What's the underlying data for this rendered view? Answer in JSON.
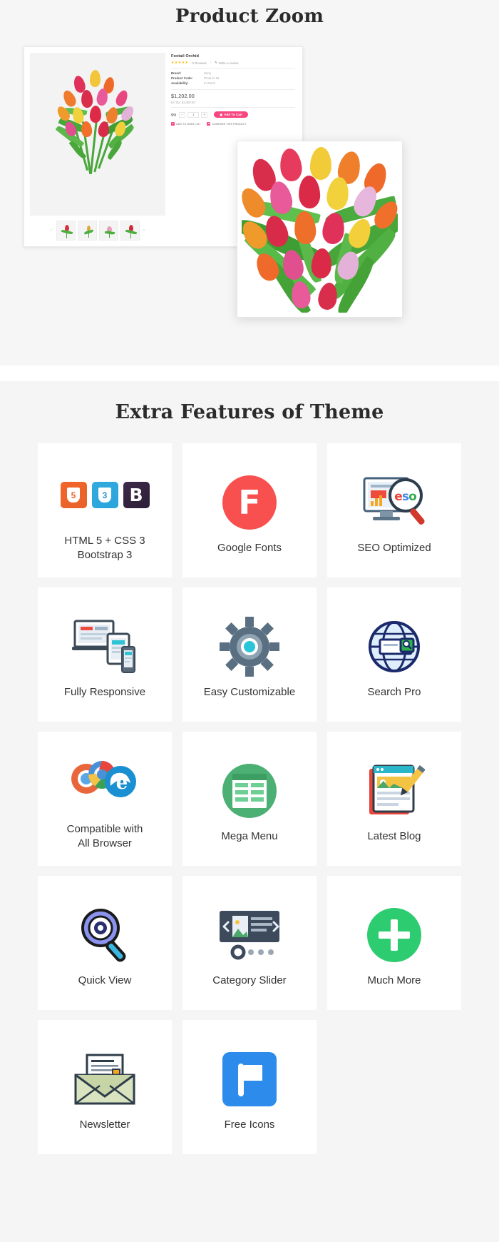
{
  "product_zoom": {
    "title": "Product Zoom",
    "product": {
      "name": "Foxtail Orchid",
      "stars": "★★★★★",
      "reviews": "0 Reviews",
      "separator": "|",
      "write_review": "Write a review",
      "pencil_icon": "pencil-icon",
      "specs": [
        {
          "key": "Brand:",
          "value": "Sony"
        },
        {
          "key": "Product Code:",
          "value": "Product 18"
        },
        {
          "key": "Availability:",
          "value": "In Stock"
        }
      ],
      "price": "$1,202.00",
      "ex_tax": "Ex Tax: $1,000.00",
      "qty_label": "Qty",
      "qty_minus": "−",
      "qty_value": "1",
      "qty_plus": "+",
      "add_to_cart": "Add To Cart",
      "cart_icon": "shopping-cart-icon",
      "wishlist": "ADD TO WISH LIST",
      "wishlist_icon": "heart-icon",
      "compare": "COMPARE THIS PRODUCT",
      "compare_icon": "exchange-icon",
      "prev_arrow": "‹",
      "next_arrow": "›",
      "thumbnails": [
        "thumbnail-1",
        "thumbnail-2",
        "thumbnail-3",
        "thumbnail-4"
      ]
    },
    "zoom_panel_name": "zoomed-product-image"
  },
  "features": {
    "title": "Extra Features of Theme",
    "cards": [
      {
        "label": "HTML 5 + CSS 3\nBootstrap 3",
        "icon": "html5-css3-bootstrap-icon",
        "label_line1": "HTML 5 + CSS 3",
        "label_line2": "Bootstrap 3"
      },
      {
        "label": "Google Fonts",
        "icon": "google-fonts-icon",
        "letter": "F"
      },
      {
        "label": "SEO Optimized",
        "icon": "seo-magnifier-icon",
        "seo_text": "seo"
      },
      {
        "label": "Fully Responsive",
        "icon": "responsive-devices-icon"
      },
      {
        "label": "Easy Customizable",
        "icon": "gear-icon"
      },
      {
        "label": "Search Pro",
        "icon": "globe-search-icon"
      },
      {
        "label": "Compatible with\nAll Browser",
        "icon": "browsers-icon",
        "label_line1": "Compatible with",
        "label_line2": "All Browser"
      },
      {
        "label": "Mega Menu",
        "icon": "mega-menu-icon"
      },
      {
        "label": "Latest Blog",
        "icon": "blog-pencil-icon"
      },
      {
        "label": "Quick View",
        "icon": "magnifier-eye-icon"
      },
      {
        "label": "Category Slider",
        "icon": "category-slider-icon"
      },
      {
        "label": "Much More",
        "icon": "plus-circle-icon"
      },
      {
        "label": "Newsletter",
        "icon": "envelope-icon"
      },
      {
        "label": "Free Icons",
        "icon": "flag-icon"
      }
    ]
  },
  "colors": {
    "page_bg": "#f5f5f5",
    "card_bg": "#ffffff",
    "accent_pink": "#f8467f",
    "html5_orange": "#f16529",
    "css3_blue": "#33aadd",
    "bootstrap_purple": "#3d2a4a",
    "google_fonts_red": "#f8504f",
    "green": "#2ecc71",
    "text_dark": "#333333"
  }
}
